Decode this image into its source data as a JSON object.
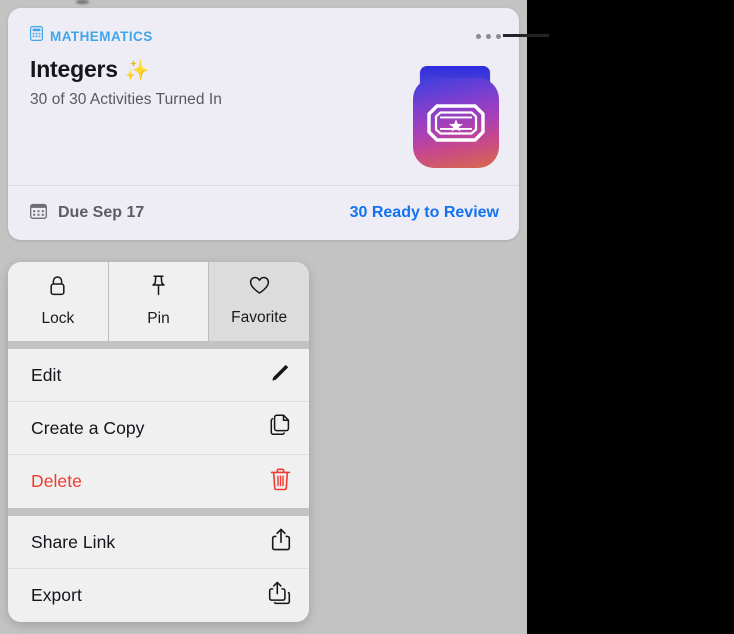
{
  "card": {
    "subject": "MATHEMATICS",
    "subject_icon": "calculator-icon",
    "title": "Integers",
    "title_emoji": "✨",
    "subtitle": "30 of 30 Activities Turned In",
    "app_icon": "ticket-star-app-icon",
    "more_icon": "ellipsis-icon",
    "due_icon": "calendar-icon",
    "due_text": "Due Sep 17",
    "review_text": "30 Ready to Review",
    "accent_color": "#1272f0",
    "subject_color": "#41a5e8",
    "background_color": "#eeedf6"
  },
  "context_menu": {
    "actions": [
      {
        "label": "Lock",
        "icon": "lock-icon",
        "highlighted": false
      },
      {
        "label": "Pin",
        "icon": "pin-icon",
        "highlighted": false
      },
      {
        "label": "Favorite",
        "icon": "heart-icon",
        "highlighted": true
      }
    ],
    "groups": [
      {
        "items": [
          {
            "label": "Edit",
            "icon": "pencil-icon",
            "destructive": false
          },
          {
            "label": "Create a Copy",
            "icon": "duplicate-icon",
            "destructive": false
          },
          {
            "label": "Delete",
            "icon": "trash-icon",
            "destructive": true
          }
        ]
      },
      {
        "items": [
          {
            "label": "Share Link",
            "icon": "share-icon",
            "destructive": false
          },
          {
            "label": "Export",
            "icon": "export-icon",
            "destructive": false
          }
        ]
      }
    ],
    "destructive_color": "#ef3b30"
  }
}
